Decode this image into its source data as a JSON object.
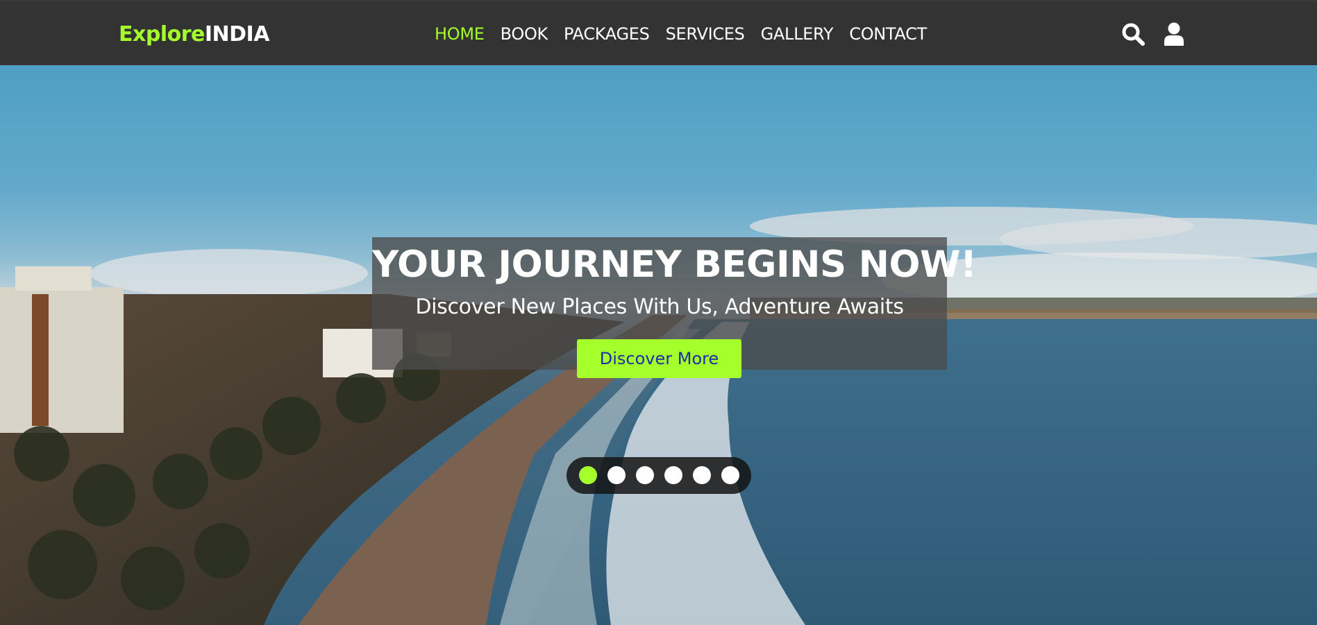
{
  "brand": {
    "part1": "Explore",
    "part2": "INDIA"
  },
  "nav": {
    "links": [
      {
        "label": "HOME",
        "active": true
      },
      {
        "label": "BOOK",
        "active": false
      },
      {
        "label": "PACKAGES",
        "active": false
      },
      {
        "label": "SERVICES",
        "active": false
      },
      {
        "label": "GALLERY",
        "active": false
      },
      {
        "label": "CONTACT",
        "active": false
      }
    ],
    "icons": [
      "search-icon",
      "user-icon"
    ]
  },
  "hero": {
    "title": "YOUR JOURNEY BEGINS NOW!",
    "subtitle": "Discover New Places With Us, Adventure Awaits",
    "cta_label": "Discover More",
    "slides_count": 6,
    "active_slide": 1
  },
  "colors": {
    "accent": "#a5ff2b",
    "navbar": "#333333",
    "cta_text": "#1a2fa8"
  }
}
